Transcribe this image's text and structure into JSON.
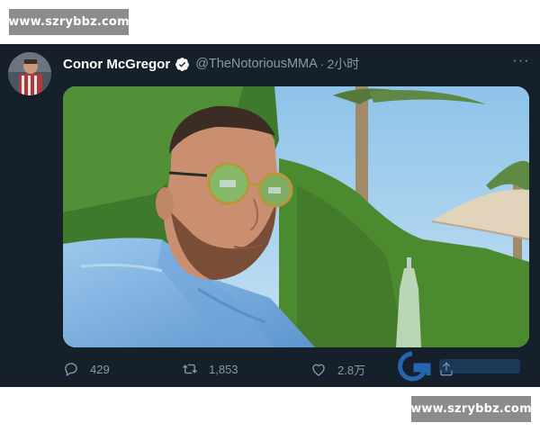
{
  "watermark": {
    "text": "www.szrybbz.com"
  },
  "tweet": {
    "author_name": "Conor McGregor",
    "handle": "@TheNotoriousMMA",
    "separator": "·",
    "time": "2小时",
    "more_label": "···",
    "verified": true,
    "avatar": "avatar-photo",
    "photo": "selfie-photo"
  },
  "actions": {
    "reply_count": "429",
    "retweet_count": "1,853",
    "like_count": "2.8万",
    "share_icon": "share-icon"
  },
  "colors": {
    "background": "#15202b",
    "text_primary": "#ffffff",
    "text_secondary": "#8b98a5",
    "verified": "#ffffff",
    "watermark_bg": "#8c8c8c"
  }
}
